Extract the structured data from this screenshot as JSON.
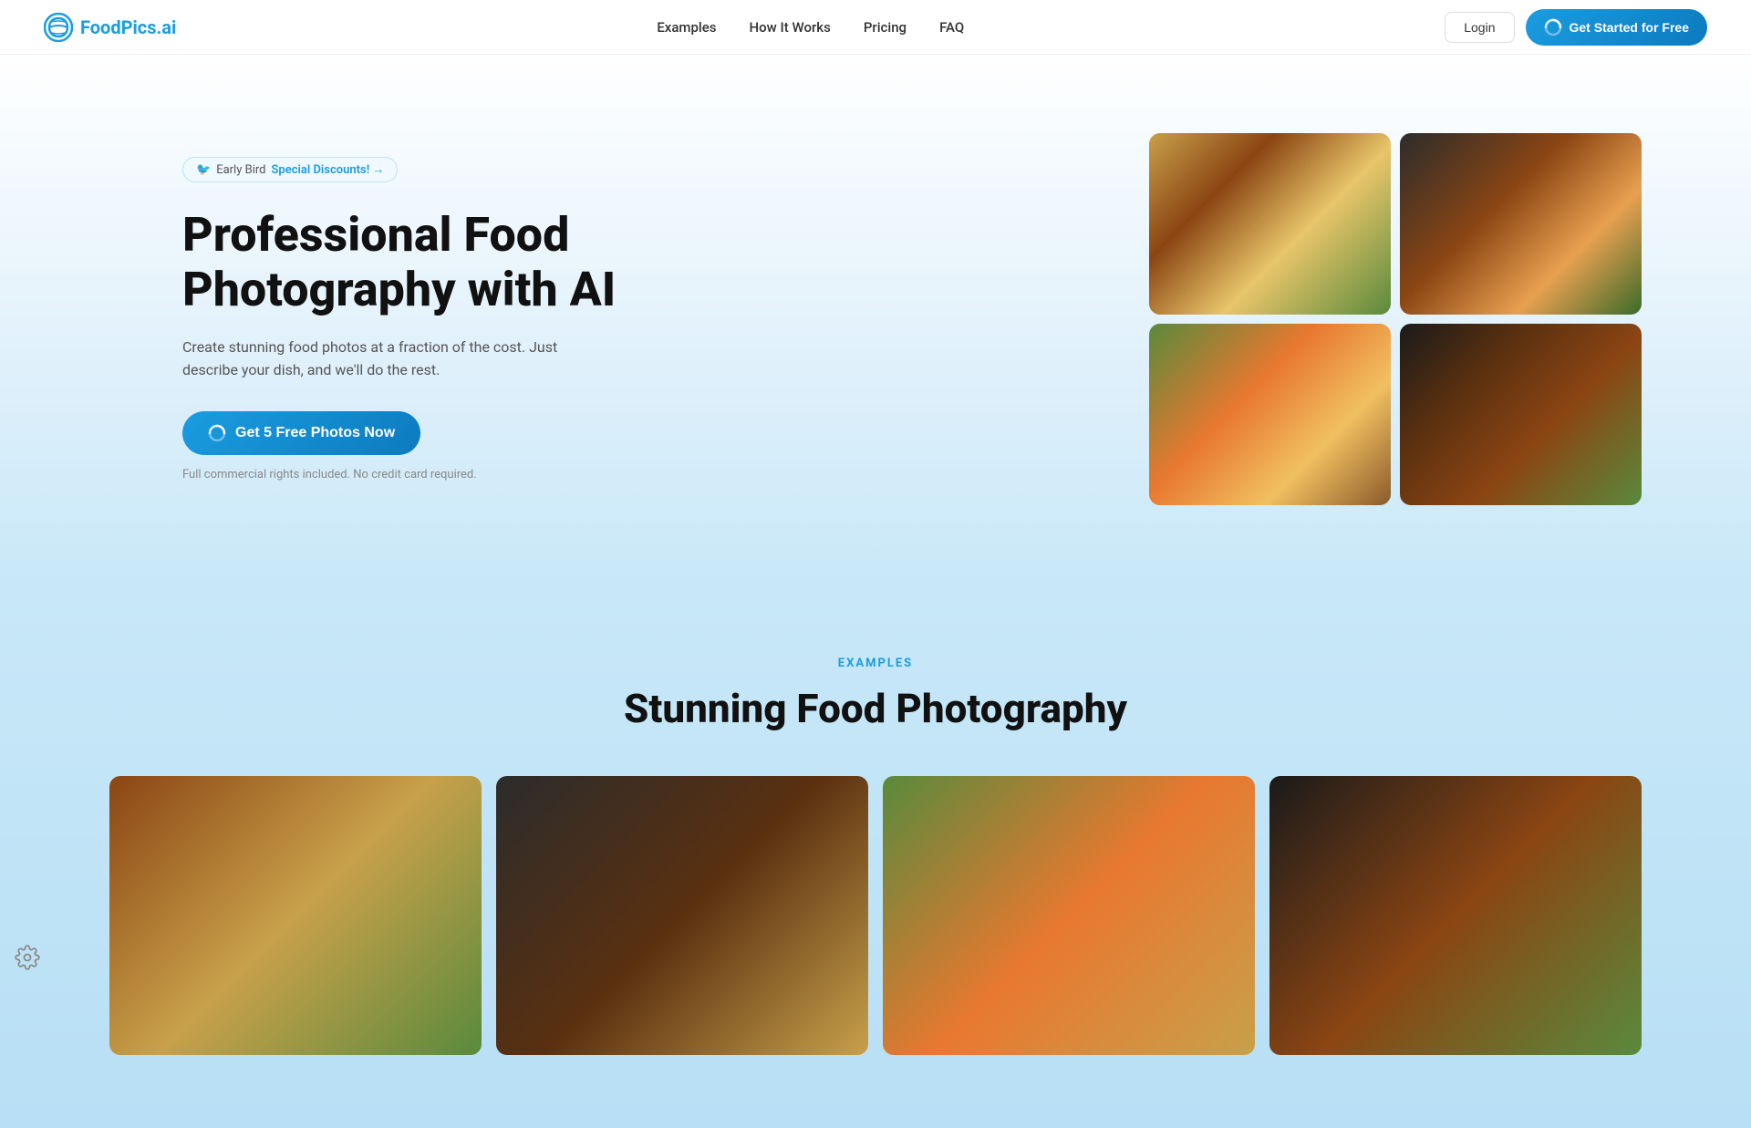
{
  "brand": {
    "name": "FoodPics.ai",
    "logo_alt": "FoodPics.ai logo"
  },
  "nav": {
    "links": [
      {
        "id": "examples",
        "label": "Examples"
      },
      {
        "id": "how-it-works",
        "label": "How It Works"
      },
      {
        "id": "pricing",
        "label": "Pricing"
      },
      {
        "id": "faq",
        "label": "FAQ"
      }
    ],
    "login_label": "Login",
    "cta_label": "Get Started for Free"
  },
  "hero": {
    "badge_emoji": "🐦",
    "badge_text": "Early Bird",
    "badge_cta": "Special Discounts! →",
    "title_line1": "Professional Food",
    "title_line2": "Photography with AI",
    "subtitle": "Create stunning food photos at a fraction of the cost. Just describe your dish, and we'll do the rest.",
    "cta_label": "Get 5 Free Photos Now",
    "disclaimer": "Full commercial rights included. No credit card required."
  },
  "examples_section": {
    "label": "EXAMPLES",
    "title": "Stunning Food Photography"
  },
  "images": {
    "hero": [
      {
        "id": "burger",
        "alt": "Burger with fries",
        "css_class": "food-burger"
      },
      {
        "id": "tacos",
        "alt": "Tacos on dark plate",
        "css_class": "food-tacos"
      },
      {
        "id": "salad",
        "alt": "Colorful salad bowl",
        "css_class": "food-salad"
      },
      {
        "id": "steak",
        "alt": "Steak with asparagus",
        "css_class": "food-steak"
      }
    ],
    "examples": [
      {
        "id": "ex1",
        "alt": "Food example 1",
        "css_class": "ex-food-1"
      },
      {
        "id": "ex2",
        "alt": "Food example 2",
        "css_class": "ex-food-2"
      },
      {
        "id": "ex3",
        "alt": "Food example 3",
        "css_class": "ex-food-3"
      },
      {
        "id": "ex4",
        "alt": "Food example 4",
        "css_class": "ex-food-4"
      }
    ]
  },
  "colors": {
    "primary": "#1a9de0",
    "cta_bg": "#1a9de0"
  }
}
